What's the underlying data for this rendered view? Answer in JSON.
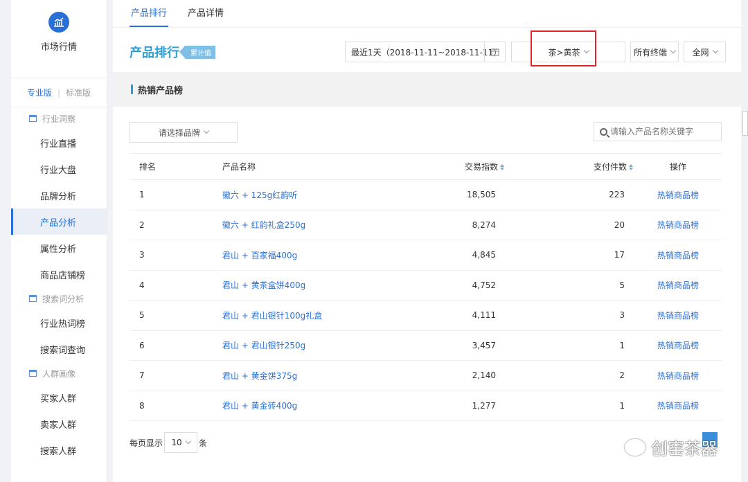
{
  "sidebar": {
    "app_title": "市场行情",
    "version_pro": "专业版",
    "version_std": "标准版",
    "groups": [
      {
        "title": "行业洞察",
        "items": [
          "行业直播",
          "行业大盘",
          "品牌分析",
          "产品分析",
          "属性分析",
          "商品店铺榜"
        ]
      },
      {
        "title": "搜索词分析",
        "items": [
          "行业热词榜",
          "搜索词查询"
        ]
      },
      {
        "title": "人群画像",
        "items": [
          "买家人群",
          "卖家人群",
          "搜索人群"
        ]
      }
    ],
    "active_item": "产品分析"
  },
  "tabs": [
    "产品排行",
    "产品详情"
  ],
  "header": {
    "title": "产品排行",
    "badge": "累计值",
    "date_range": "最近1天（2018-11-11~2018-11-11）",
    "category": "茶>黄茶",
    "terminal": "所有终端",
    "network": "全网"
  },
  "section_title": "热销产品榜",
  "filters": {
    "brand_placeholder": "请选择品牌",
    "search_placeholder": "请输入产品名称关键字"
  },
  "table": {
    "headers": {
      "rank": "排名",
      "name": "产品名称",
      "index": "交易指数",
      "count": "支付件数",
      "op": "操作"
    },
    "rows": [
      {
        "rank": "1",
        "name": "徽六 + 125g红韵听",
        "index": "18,505",
        "count": "223",
        "op": "热销商品榜"
      },
      {
        "rank": "2",
        "name": "徽六 + 红韵礼盒250g",
        "index": "8,274",
        "count": "20",
        "op": "热销商品榜"
      },
      {
        "rank": "3",
        "name": "君山 + 百家福400g",
        "index": "4,845",
        "count": "17",
        "op": "热销商品榜"
      },
      {
        "rank": "4",
        "name": "君山 + 黄茶盒饼400g",
        "index": "4,752",
        "count": "5",
        "op": "热销商品榜"
      },
      {
        "rank": "5",
        "name": "君山 + 君山银针100g礼盒",
        "index": "4,111",
        "count": "3",
        "op": "热销商品榜"
      },
      {
        "rank": "6",
        "name": "君山 + 君山银针250g",
        "index": "3,457",
        "count": "1",
        "op": "热销商品榜"
      },
      {
        "rank": "7",
        "name": "君山 + 黄金饼375g",
        "index": "2,140",
        "count": "2",
        "op": "热销商品榜"
      },
      {
        "rank": "8",
        "name": "君山 + 黄金砖400g",
        "index": "1,277",
        "count": "1",
        "op": "热销商品榜"
      }
    ]
  },
  "pager": {
    "prefix": "每页显示",
    "size": "10",
    "suffix": "条"
  },
  "watermark": "创窑茶器"
}
